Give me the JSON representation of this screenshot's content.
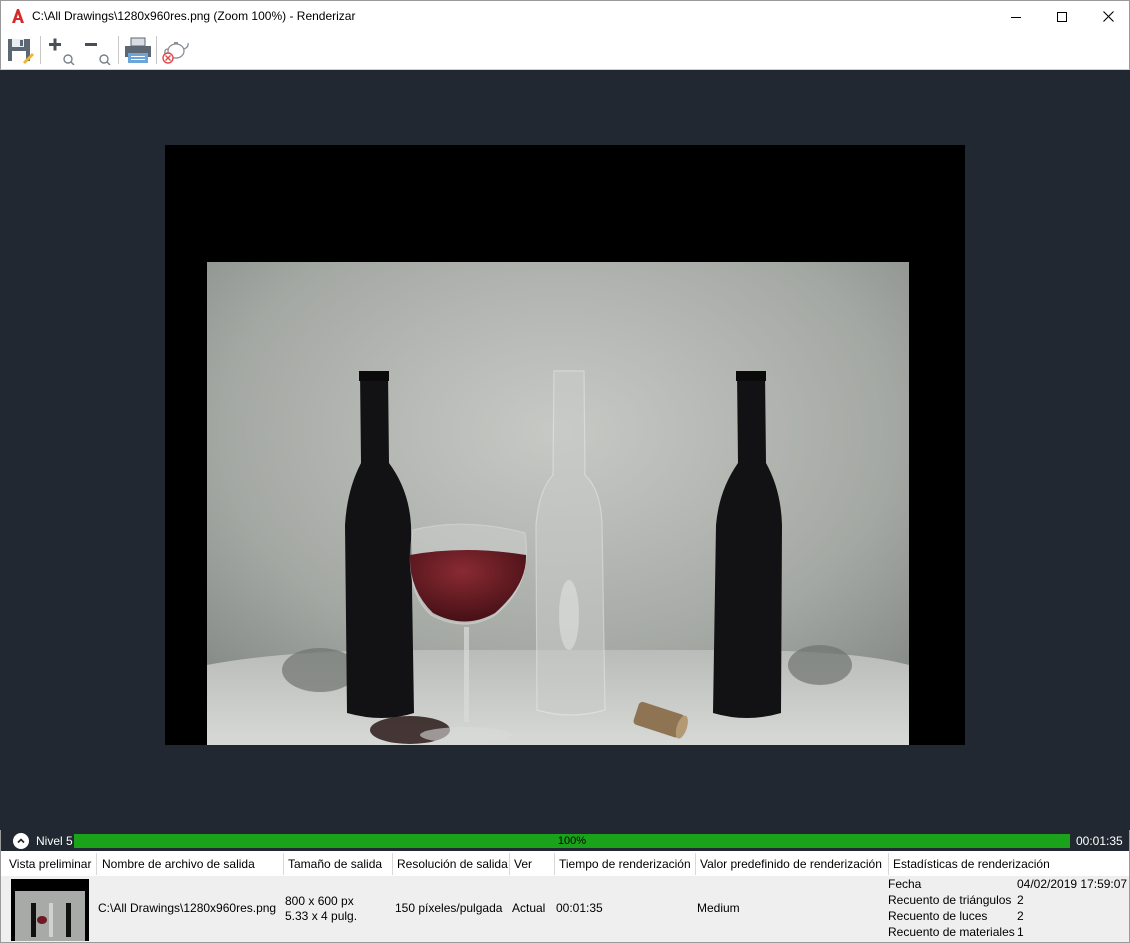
{
  "window": {
    "title": "C:\\All Drawings\\1280x960res.png (Zoom 100%) - Renderizar",
    "app_icon": "autocad-a-icon"
  },
  "toolbar": {
    "items": [
      "save-icon",
      "zoom-in-icon",
      "zoom-out-icon",
      "print-icon",
      "cancel-render-teapot-icon"
    ]
  },
  "status": {
    "level": "Nivel 5",
    "progress_text": "100%",
    "progress": 1.0,
    "elapsed": "00:01:35",
    "colors": {
      "progress": "#1aa31a",
      "background": "#222831"
    }
  },
  "history": {
    "headers": [
      "Vista preliminar",
      "Nombre de archivo de salida",
      "Tamaño de salida",
      "Resolución de salida",
      "Ver",
      "Tiempo de renderización",
      "Valor predefinido de renderización",
      "Estadísticas de renderización"
    ],
    "row": {
      "filename": "C:\\All Drawings\\1280x960res.png",
      "size_px": "800 x 600 px",
      "size_in": "5.33 x 4 pulg.",
      "resolution": "150 píxeles/pulgada",
      "view": "Actual",
      "time": "00:01:35",
      "preset": "Medium",
      "stats": [
        {
          "label": "Fecha",
          "value": "04/02/2019 17:59:07"
        },
        {
          "label": "Recuento de triángulos",
          "value": "2"
        },
        {
          "label": "Recuento de luces",
          "value": "2"
        },
        {
          "label": "Recuento de materiales",
          "value": "1"
        }
      ]
    }
  }
}
